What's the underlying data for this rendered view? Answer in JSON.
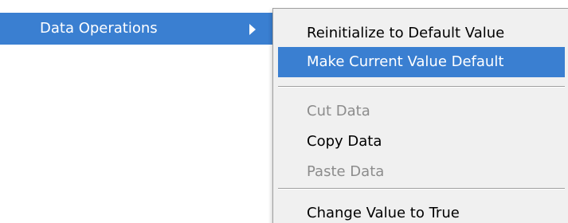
{
  "parent_menu": {
    "label": "Data Operations",
    "arrow_icon": "submenu-arrow-icon"
  },
  "submenu": {
    "items": [
      {
        "label": "Reinitialize to Default Value",
        "state": "normal"
      },
      {
        "label": "Make Current Value Default",
        "state": "highlighted"
      },
      {
        "label": "Cut Data",
        "state": "disabled"
      },
      {
        "label": "Copy Data",
        "state": "normal"
      },
      {
        "label": "Paste Data",
        "state": "disabled"
      },
      {
        "label": "Change Value to True",
        "state": "normal"
      }
    ]
  },
  "colors": {
    "highlight": "#3a7fd1",
    "menu_background": "#f0f0f0",
    "disabled_text": "#8c8c8c"
  }
}
